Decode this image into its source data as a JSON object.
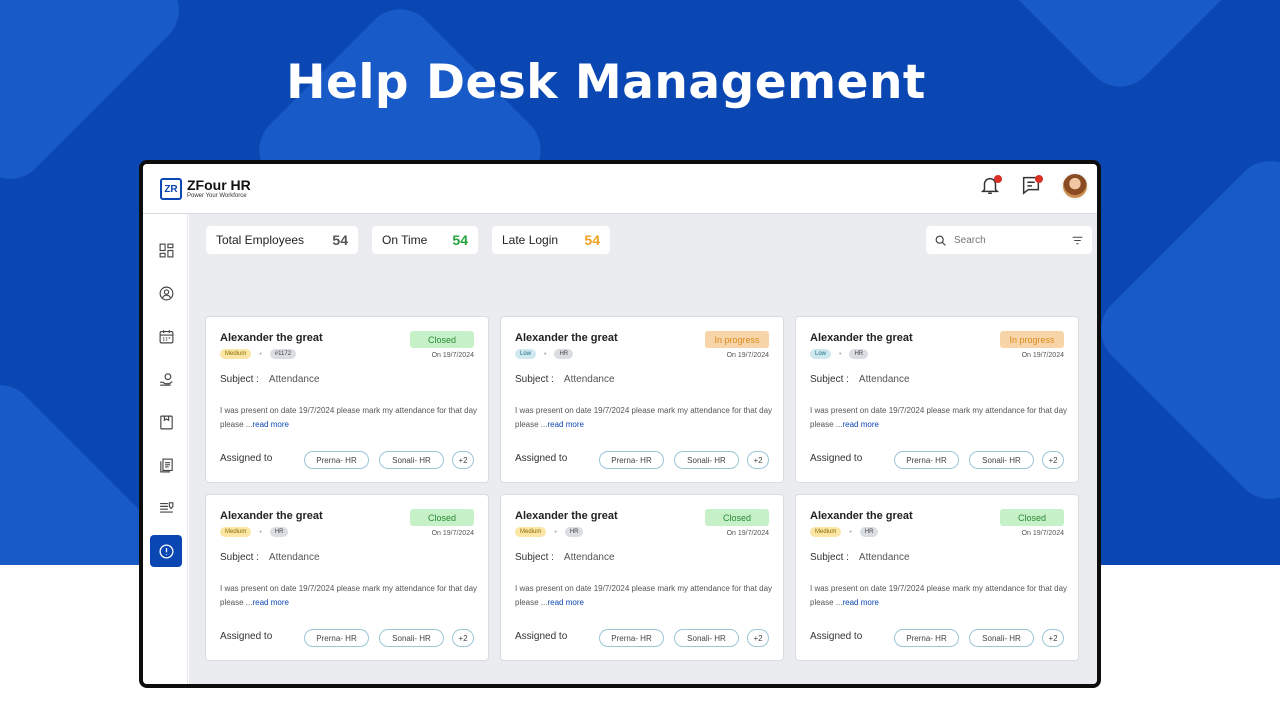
{
  "headline": "Help Desk Management",
  "app": {
    "name": "ZFour HR",
    "tagline": "Power Your Workforce",
    "logo_mark": "ZR"
  },
  "topbar": {
    "icons": [
      "bell-icon",
      "chat-icon"
    ],
    "avatar": "user-avatar"
  },
  "sidebar": {
    "items": [
      "dashboard-icon",
      "user-icon",
      "calendar-icon",
      "payroll-icon",
      "document-icon",
      "files-icon",
      "policy-icon",
      "helpdesk-icon"
    ],
    "active": "helpdesk-icon"
  },
  "stats": [
    {
      "label": "Total Employees",
      "value": "54"
    },
    {
      "label": "On Time",
      "value": "54"
    },
    {
      "label": "Late Login",
      "value": "54"
    }
  ],
  "search": {
    "placeholder": "Search"
  },
  "colors": {
    "brand": "#0a47b3",
    "closed": "#2a8a33",
    "in_progress": "#d98a1f",
    "on_time": "#23a33a",
    "late": "#f0a020"
  },
  "tickets": [
    {
      "name": "Alexander the great",
      "priority": "Medium",
      "tag": "#1172",
      "status": "Closed",
      "date": "On 19/7/2024",
      "subject_label": "Subject :",
      "subject": "Attendance",
      "description": "I was present on date 19/7/2024 please mark my attendance for that day please ...",
      "read_more": "read more",
      "assigned_label": "Assigned to",
      "assignees": [
        "Prerna- HR",
        "Sonali- HR"
      ],
      "more": "+2"
    },
    {
      "name": "Alexander the great",
      "priority": "Low",
      "tag": "HR",
      "status": "In progress",
      "date": "On 19/7/2024",
      "subject_label": "Subject :",
      "subject": "Attendance",
      "description": "I was present on date 19/7/2024 please mark my attendance for that day please ...",
      "read_more": "read more",
      "assigned_label": "Assigned to",
      "assignees": [
        "Prerna- HR",
        "Sonali- HR"
      ],
      "more": "+2"
    },
    {
      "name": "Alexander the great",
      "priority": "Low",
      "tag": "HR",
      "status": "In progress",
      "date": "On 19/7/2024",
      "subject_label": "Subject :",
      "subject": "Attendance",
      "description": "I was present on date 19/7/2024 please mark my attendance for that day please ...",
      "read_more": "read more",
      "assigned_label": "Assigned to",
      "assignees": [
        "Prerna- HR",
        "Sonali- HR"
      ],
      "more": "+2"
    },
    {
      "name": "Alexander the great",
      "priority": "Medium",
      "tag": "HR",
      "status": "Closed",
      "date": "On 19/7/2024",
      "subject_label": "Subject :",
      "subject": "Attendance",
      "description": "I was present on date 19/7/2024 please mark my attendance for that day please ...",
      "read_more": "read more",
      "assigned_label": "Assigned to",
      "assignees": [
        "Prerna- HR",
        "Sonali- HR"
      ],
      "more": "+2"
    },
    {
      "name": "Alexander the great",
      "priority": "Medium",
      "tag": "HR",
      "status": "Closed",
      "date": "On 19/7/2024",
      "subject_label": "Subject :",
      "subject": "Attendance",
      "description": "I was present on date 19/7/2024 please mark my attendance for that day please ...",
      "read_more": "read more",
      "assigned_label": "Assigned to",
      "assignees": [
        "Prerna- HR",
        "Sonali- HR"
      ],
      "more": "+2"
    },
    {
      "name": "Alexander the great",
      "priority": "Medium",
      "tag": "HR",
      "status": "Closed",
      "date": "On 19/7/2024",
      "subject_label": "Subject :",
      "subject": "Attendance",
      "description": "I was present on date 19/7/2024 please mark my attendance for that day please ...",
      "read_more": "read more",
      "assigned_label": "Assigned to",
      "assignees": [
        "Prerna- HR",
        "Sonali- HR"
      ],
      "more": "+2"
    }
  ]
}
